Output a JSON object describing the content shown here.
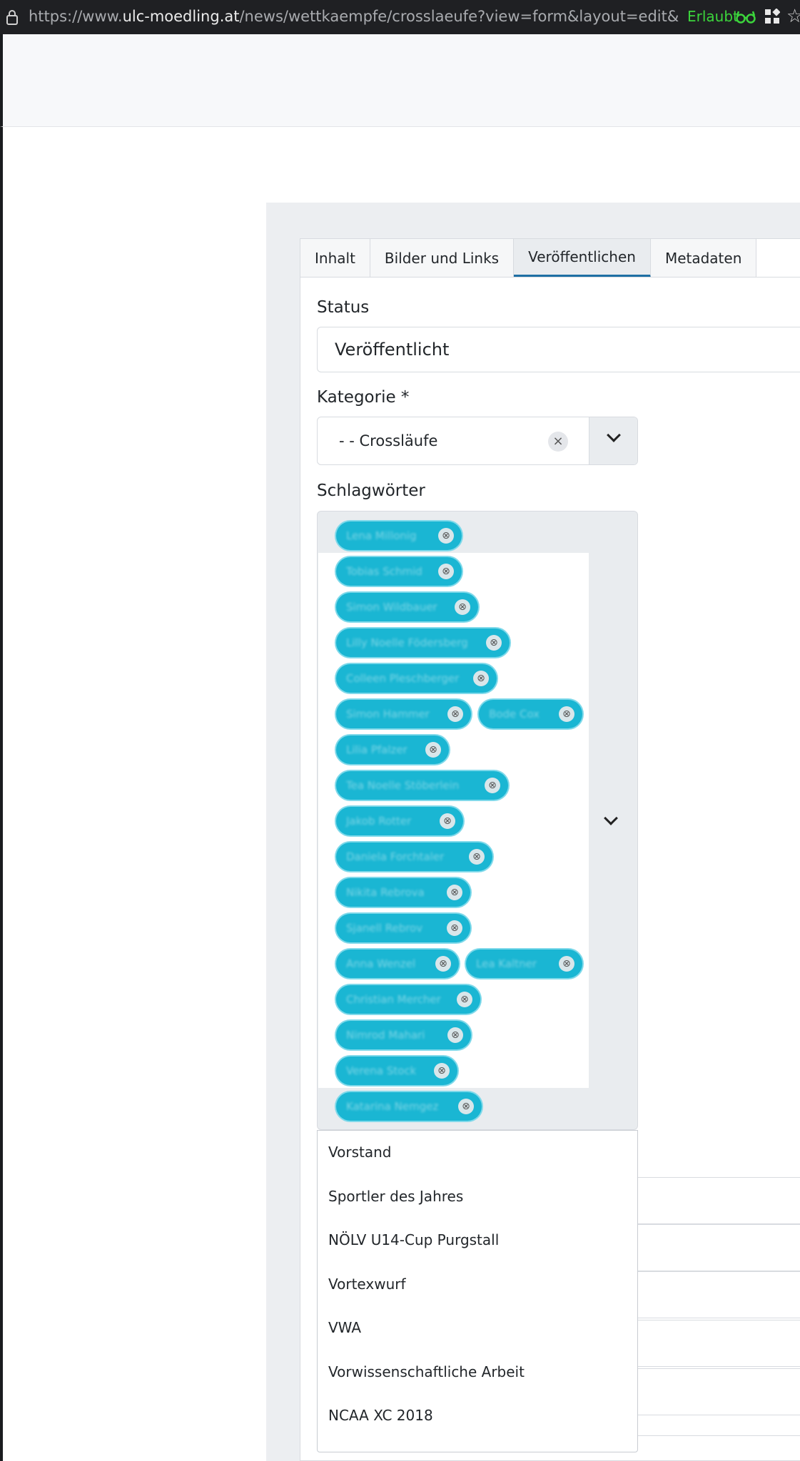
{
  "browser": {
    "url_prefix": "https://www.",
    "url_host": "ulc-moedling.at",
    "url_rest": "/news/wettkaempfe/crosslaeufe?view=form&layout=edit&a_id=1754&",
    "permission": "Erlaubt",
    "icons": [
      "lock-icon",
      "glasses-icon",
      "extensions-icon",
      "star-icon"
    ]
  },
  "tabs": [
    {
      "label": "Inhalt",
      "active": false
    },
    {
      "label": "Bilder und Links",
      "active": false
    },
    {
      "label": "Veröffentlichen",
      "active": true
    },
    {
      "label": "Metadaten",
      "active": false
    }
  ],
  "status": {
    "label": "Status",
    "value": "Veröffentlicht"
  },
  "category": {
    "label": "Kategorie *",
    "value": "- - Crossläufe",
    "clear_icon": "×"
  },
  "tags": {
    "label": "Schlagwörter",
    "items": [
      "Lena Millonig",
      "Tobias Schmid",
      "Simon Wildbauer",
      "Lilly Noelle Födersberg",
      "Colleen Pleschberger",
      "Simon Hammer",
      "Bode Cox",
      "Lilia Pfalzer",
      "Tea Noelle Stöberlein",
      "Jakob Rotter",
      "Daniela Forchtaler",
      "Nikita Rebrova",
      "Sjanell Rebrov",
      "Anna Wenzel",
      "Lea Kaltner",
      "Christian Mercher",
      "Nimrod Mahari",
      "Verena Stock",
      "Katarina Nemgez"
    ]
  },
  "dropdown": {
    "options": [
      "Vorstand",
      "Sportler des Jahres",
      "NÖLV U14-Cup Purgstall",
      "Vortexwurf",
      "VWA",
      "Vorwissenschaftliche Arbeit",
      "NCAA XC 2018"
    ]
  },
  "colors": {
    "tag_bg": "#1ab6d3",
    "active_tab_underline": "#1e6fa3",
    "permission": "#3cd53c"
  }
}
